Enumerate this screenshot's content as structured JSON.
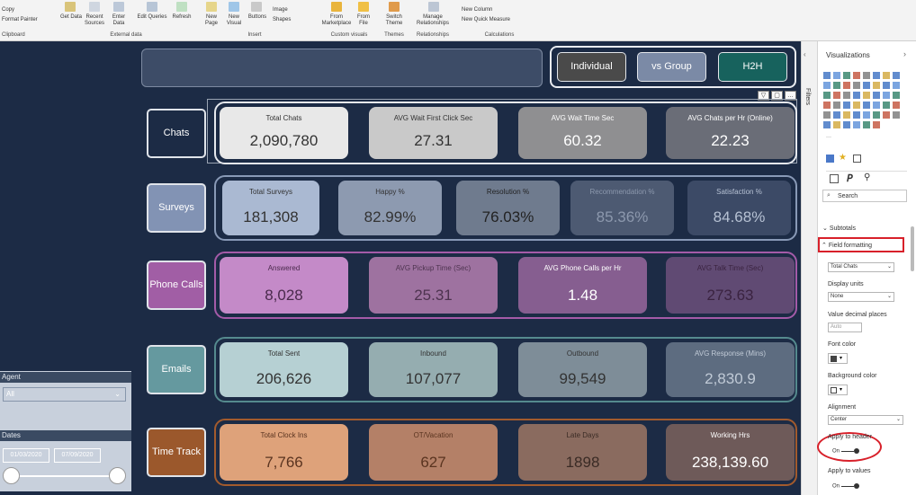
{
  "ribbon": {
    "clipboard": {
      "copy": "Copy",
      "format_painter": "Format Painter",
      "group": "Clipboard"
    },
    "external_data": {
      "get_data": "Get Data",
      "recent_sources": "Recent Sources",
      "enter_data": "Enter Data",
      "edit_queries": "Edit Queries",
      "refresh": "Refresh",
      "group": "External data"
    },
    "insert": {
      "new_page": "New Page",
      "new_visual": "New Visual",
      "buttons": "Buttons",
      "image": "Image",
      "shapes": "Shapes",
      "group": "Insert"
    },
    "custom_visuals": {
      "from_marketplace": "From Marketplace",
      "from_file": "From File",
      "group": "Custom visuals"
    },
    "themes": {
      "switch_theme": "Switch Theme",
      "group": "Themes"
    },
    "relationships": {
      "manage": "Manage Relationships",
      "group": "Relationships"
    },
    "calculations": {
      "new_column": "New Column",
      "new_quick_measure": "New Quick Measure",
      "group": "Calculations"
    }
  },
  "toggles": [
    {
      "label": "Individual",
      "color": "#4a4a4a"
    },
    {
      "label": "vs Group",
      "color": "#7b8aa6"
    },
    {
      "label": "H2H",
      "color": "#17625d"
    }
  ],
  "rows": [
    {
      "label": "Chats",
      "label_bg": "#1c2b45",
      "frame": "#e6e9ee",
      "cards": [
        {
          "title": "Total Chats",
          "value": "2,090,780",
          "bg": "#e8e8e8",
          "fg": "#333333"
        },
        {
          "title": "AVG Wait First Click Sec",
          "value": "27.31",
          "bg": "#c9c9c9",
          "fg": "#333333"
        },
        {
          "title": "AVG Wait Time Sec",
          "value": "60.32",
          "bg": "#8f8f91",
          "fg": "#ffffff"
        },
        {
          "title": "AVG Chats per Hr (Online)",
          "value": "22.23",
          "bg": "#6a6d77",
          "fg": "#ffffff"
        }
      ]
    },
    {
      "label": "Surveys",
      "label_bg": "#8293b4",
      "frame": "#8899b6",
      "cards": [
        {
          "title": "Total Surveys",
          "value": "181,308",
          "bg": "#aab9d2",
          "fg": "#333333"
        },
        {
          "title": "Happy %",
          "value": "82.99%",
          "bg": "#8d9ab0",
          "fg": "#333333"
        },
        {
          "title": "Resolution %",
          "value": "76.03%",
          "bg": "#6f7b8e",
          "fg": "#222222"
        },
        {
          "title": "Recommendation %",
          "value": "85.36%",
          "bg": "#4d5a72",
          "fg": "#8c98ad"
        },
        {
          "title": "Satisfaction %",
          "value": "84.68%",
          "bg": "#3c4a66",
          "fg": "#b6c1d3"
        }
      ]
    },
    {
      "label": "Phone Calls",
      "label_bg": "#a15ea5",
      "frame": "#a45ba8",
      "cards": [
        {
          "title": "Answered",
          "value": "8,028",
          "bg": "#c48ac8",
          "fg": "#4a2a4c"
        },
        {
          "title": "AVG Pickup Time (Sec)",
          "value": "25.31",
          "bg": "#9e72a0",
          "fg": "#4d334f"
        },
        {
          "title": "AVG Phone Calls per Hr",
          "value": "1.48",
          "bg": "#865e90",
          "fg": "#ffffff"
        },
        {
          "title": "AVG Talk Time (Sec)",
          "value": "273.63",
          "bg": "#604a73",
          "fg": "#3a2340"
        }
      ]
    },
    {
      "label": "Emails",
      "label_bg": "#65999f",
      "frame": "#558a8e",
      "cards": [
        {
          "title": "Total Sent",
          "value": "206,626",
          "bg": "#b6d0d3",
          "fg": "#333333"
        },
        {
          "title": "Inbound",
          "value": "107,077",
          "bg": "#95adb0",
          "fg": "#333333"
        },
        {
          "title": "Outbound",
          "value": "99,549",
          "bg": "#7e8d98",
          "fg": "#333333"
        },
        {
          "title": "AVG Response (Mins)",
          "value": "2,830.9",
          "bg": "#5d6c80",
          "fg": "#c0cad6"
        }
      ]
    },
    {
      "label": "Time Track",
      "label_bg": "#9b582c",
      "frame": "#a35b2d",
      "cards": [
        {
          "title": "Total Clock Ins",
          "value": "7,766",
          "bg": "#dea27a",
          "fg": "#5a3420"
        },
        {
          "title": "OT/Vacation",
          "value": "627",
          "bg": "#b48067",
          "fg": "#5a3420"
        },
        {
          "title": "Late Days",
          "value": "1898",
          "bg": "#8a6b5f",
          "fg": "#3a2b25"
        },
        {
          "title": "Working Hrs",
          "value": "238,139.60",
          "bg": "#6e5a59",
          "fg": "#ffffff"
        }
      ]
    }
  ],
  "slicers": {
    "agent_label": "Agent",
    "agent_value": "All",
    "dates_label": "Dates",
    "date_start": "01/03/2020",
    "date_end": "07/09/2020"
  },
  "filters_label": "Filters",
  "viz_pane": {
    "title": "Visualizations",
    "search_placeholder": "Search",
    "subtotals": "Subtotals",
    "field_formatting": "Field formatting",
    "field_value": "Total Chats",
    "display_units_label": "Display units",
    "display_units_value": "None",
    "decimal_label": "Value decimal places",
    "decimal_value": "Auto",
    "font_color_label": "Font color",
    "bg_color_label": "Background color",
    "alignment_label": "Alignment",
    "alignment_value": "Center",
    "apply_header_label": "Apply to header",
    "apply_header_value": "On",
    "apply_values_label": "Apply to values",
    "apply_values_value": "On",
    "highlight_color": "#d8202a"
  }
}
